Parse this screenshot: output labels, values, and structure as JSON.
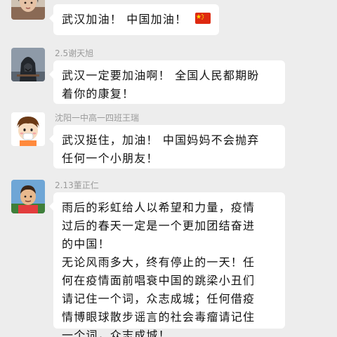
{
  "messages": [
    {
      "sender": "",
      "avatar": "woman-portrait-avatar",
      "lines": [
        "武汉加油！ 中国加油！"
      ],
      "emoji": "china-flag-icon"
    },
    {
      "sender": "2.5谢天旭",
      "avatar": "hooded-assassin-avatar",
      "lines": [
        "武汉一定要加油啊！ 全国人民都期盼",
        "着你的康复！"
      ]
    },
    {
      "sender": "沈阳一中高一四班王瑞",
      "avatar": "cartoon-kid-avatar",
      "lines": [
        "武汉挺住，加油！ 中国妈妈不会抛弃",
        "任何一个小朋友！"
      ]
    },
    {
      "sender": "2.13董正仁",
      "avatar": "cartoon-soccer-player-avatar",
      "lines": [
        "雨后的彩虹给人以希望和力量，疫情",
        "过后的春天一定是一个更加团结奋进",
        "的中国！",
        "无论风雨多大，终有停止的一天！任",
        "何在疫情面前唱衰中国的跳梁小丑们",
        "请记住一个词，众志成城；任何借疫",
        "情博眼球散步谣言的社会毒瘤请记住",
        "一个词，众志成城！"
      ]
    }
  ]
}
